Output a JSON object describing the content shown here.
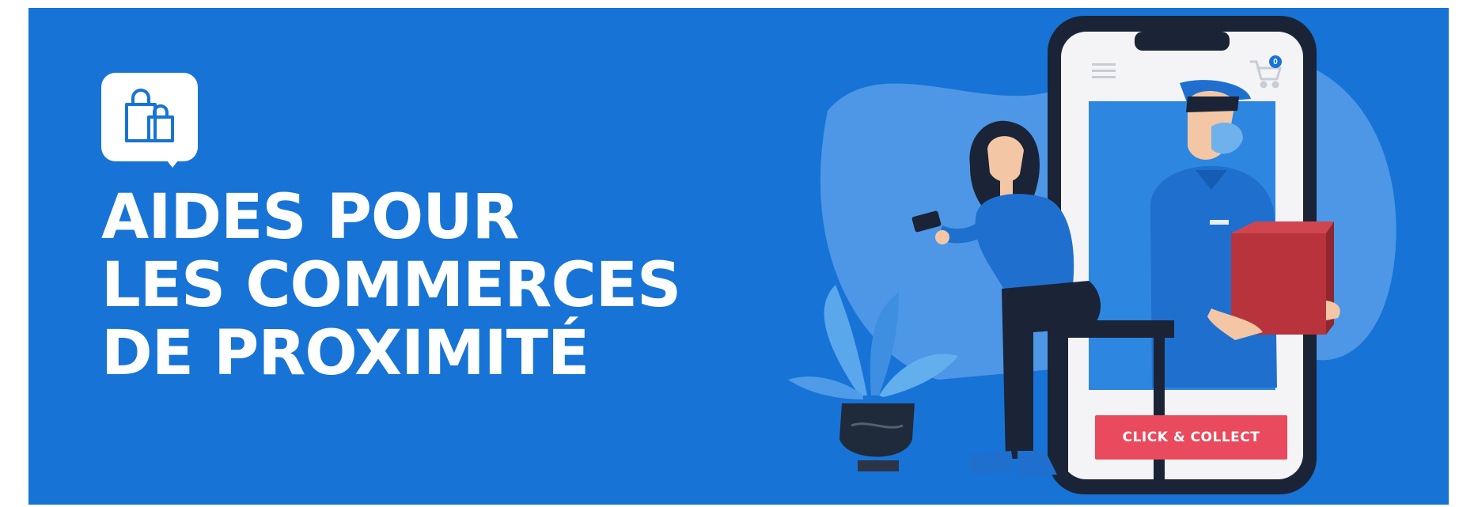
{
  "banner": {
    "headline_lines": [
      "AIDES POUR",
      "LES COMMERCES",
      "DE PROXIMITÉ"
    ],
    "icon": "shopping-bags-icon",
    "background_color": "#1773d6"
  },
  "phone": {
    "cta_label": "CLICK & COLLECT",
    "cart_count": "0",
    "menu_icon": "hamburger-menu-icon",
    "cart_icon": "shopping-cart-icon",
    "cta_color": "#e94a5d"
  }
}
